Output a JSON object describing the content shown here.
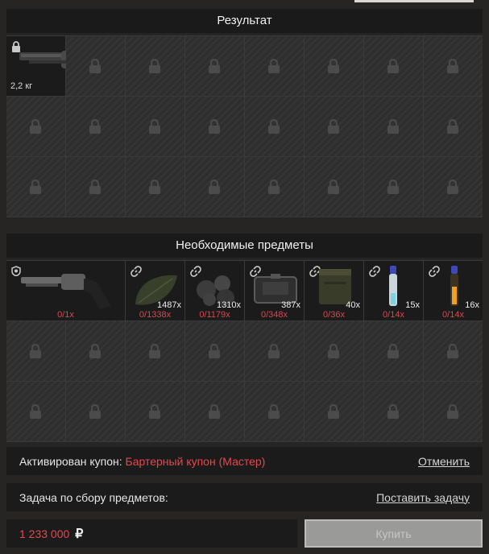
{
  "result_section": {
    "title": "Результат",
    "item": {
      "weight": "2,2 кг",
      "icon": "lock-icon"
    }
  },
  "required_section": {
    "title": "Необходимые предметы",
    "items": [
      {
        "qty": "",
        "need": "0/1x",
        "icon": "shield-icon"
      },
      {
        "qty": "1487x",
        "need": "0/1338x",
        "icon": "link-icon"
      },
      {
        "qty": "1310x",
        "need": "0/1179x",
        "icon": "link-icon"
      },
      {
        "qty": "387x",
        "need": "0/348x",
        "icon": "link-icon"
      },
      {
        "qty": "40x",
        "need": "0/36x",
        "icon": "link-icon"
      },
      {
        "qty": "15x",
        "need": "0/14x",
        "icon": "link-icon"
      },
      {
        "qty": "16x",
        "need": "0/14x",
        "icon": "link-icon"
      }
    ]
  },
  "coupon": {
    "label": "Активирован купон:",
    "name": "Бартерный купон (Мастер)",
    "cancel": "Отменить"
  },
  "task": {
    "label": "Задача по сбору предметов:",
    "action": "Поставить задачу"
  },
  "purchase": {
    "price": "1 233 000",
    "currency": "₽",
    "buy_label": "Купить"
  },
  "colors": {
    "accent_red": "#e5484d",
    "panel_bg": "#1b1b1b"
  }
}
